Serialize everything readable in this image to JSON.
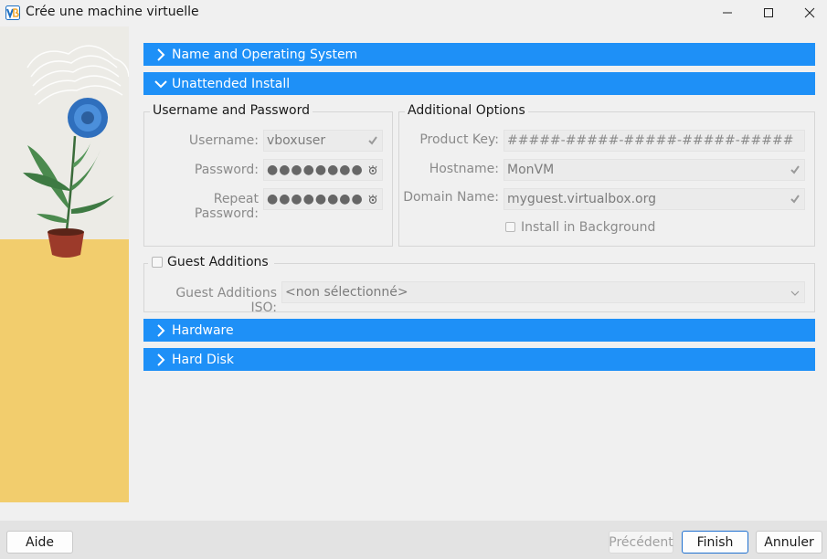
{
  "window": {
    "title": "Crée une machine virtuelle",
    "controls": [
      "minimize",
      "maximize",
      "close"
    ]
  },
  "colors": {
    "section_bar": "#1e90f7",
    "primary_border": "#1e70d0",
    "illustration_floor": "#f2cd6d",
    "illustration_wall": "#ecebe6"
  },
  "sections": {
    "name_os": {
      "label": "Name and Operating System",
      "expanded": false
    },
    "unattended": {
      "label": "Unattended Install",
      "expanded": true
    },
    "hardware": {
      "label": "Hardware",
      "expanded": false
    },
    "hard_disk": {
      "label": "Hard Disk",
      "expanded": false
    }
  },
  "unattended": {
    "user_group": {
      "title": "Username and Password",
      "username_label": "Username:",
      "username_value": "vboxuser",
      "password_label": "Password:",
      "password_value": "●●●●●●●●",
      "repeat_label": "Repeat Password:",
      "repeat_value": "●●●●●●●●"
    },
    "options_group": {
      "title": "Additional Options",
      "product_key_label": "Product Key:",
      "product_key_placeholder": "#####-#####-#####-#####-#####",
      "hostname_label": "Hostname:",
      "hostname_value": "MonVM",
      "domain_label": "Domain Name:",
      "domain_value": "myguest.virtualbox.org",
      "install_bg_label": "Install in Background",
      "install_bg_checked": false
    },
    "guest_additions": {
      "label": "Guest Additions",
      "checked": false,
      "iso_label": "Guest Additions ISO:",
      "iso_value": "<non sélectionné>"
    }
  },
  "footer": {
    "help": "Aide",
    "back": "Précédent",
    "finish": "Finish",
    "cancel": "Annuler"
  }
}
